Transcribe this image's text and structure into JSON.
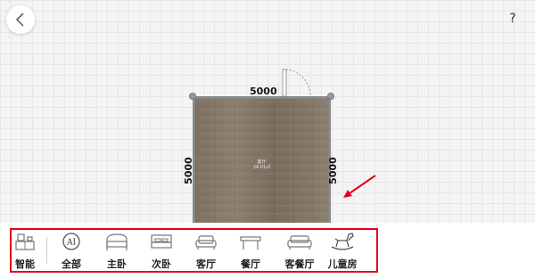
{
  "nav": {
    "help_symbol": "?"
  },
  "room": {
    "name": "客厅",
    "area": "24.01㎡",
    "dim_top": "5000",
    "dim_left": "5000",
    "dim_right": "5000"
  },
  "colors": {
    "highlight": "#e3001b",
    "wall": "#888888",
    "floor": "#8a7a6a"
  },
  "toolbar": {
    "items": [
      {
        "label": "智能",
        "icon": "smart-icon"
      },
      {
        "label": "全部",
        "icon": "ai-all-icon"
      },
      {
        "label": "主卧",
        "icon": "master-bed-icon"
      },
      {
        "label": "次卧",
        "icon": "second-bed-icon"
      },
      {
        "label": "客厅",
        "icon": "sofa-icon"
      },
      {
        "label": "餐厅",
        "icon": "dining-table-icon"
      },
      {
        "label": "客餐厅",
        "icon": "living-dining-icon"
      },
      {
        "label": "儿童房",
        "icon": "rocking-horse-icon"
      }
    ],
    "ai_badge": "AI"
  }
}
